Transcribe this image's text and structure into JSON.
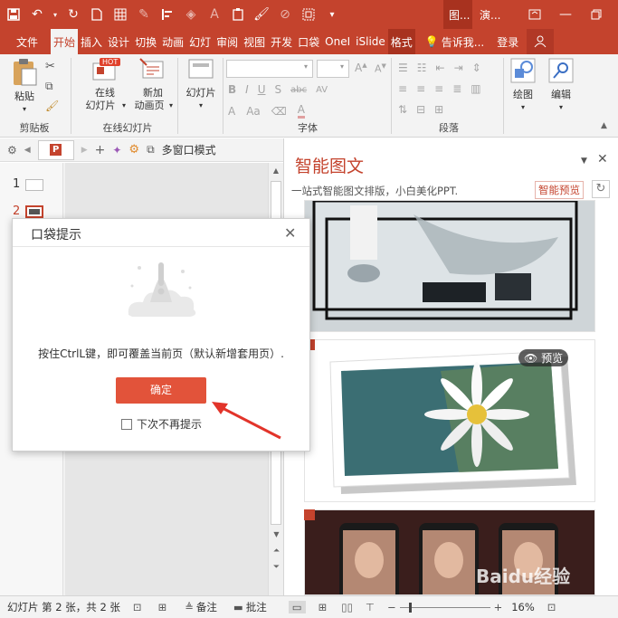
{
  "titlebar": {
    "context_tabs": [
      "图...",
      "演..."
    ],
    "accent": "#c4432d"
  },
  "tabs": [
    "文件",
    "开始",
    "插入",
    "设计",
    "切换",
    "动画",
    "幻灯",
    "审阅",
    "视图",
    "开发",
    "口袋",
    "OneI",
    "iSlide",
    "格式"
  ],
  "tell_me": "告诉我...",
  "login": "登录",
  "ribbon": {
    "paste": "粘贴",
    "clipboard_group": "剪贴板",
    "online_slides_line1": "在线",
    "online_slides_line2": "幻灯片",
    "hot_badge": "HOT",
    "new_anim_line1": "新加",
    "new_anim_line2": "动画页",
    "online_group": "在线幻灯片",
    "slide_btn": "幻灯片",
    "font_group": "字体",
    "para_group": "段落",
    "draw": "绘图",
    "edit": "编辑",
    "font_btns": [
      "B",
      "I",
      "U",
      "S",
      "abc",
      "AV",
      "Aa",
      "A"
    ]
  },
  "toolrow": {
    "multi_window": "多窗口模式"
  },
  "slides": {
    "numbers": [
      "1",
      "2"
    ]
  },
  "right_pane": {
    "title": "智能图文",
    "subtitle": "一站式智能图文排版，小白美化PPT.",
    "preview_btn": "智能预览",
    "card_preview": "预览"
  },
  "dialog": {
    "title": "口袋提示",
    "message": "按住CtrlL键，即可覆盖当前页（默认新增套用页）.",
    "ok": "确定",
    "checkbox_label": "下次不再提示"
  },
  "statusbar": {
    "slide_info": "幻灯片 第 2 张，共 2 张",
    "notes": "备注",
    "comments": "批注",
    "zoom": "16%"
  },
  "watermark": "Baidu经验"
}
